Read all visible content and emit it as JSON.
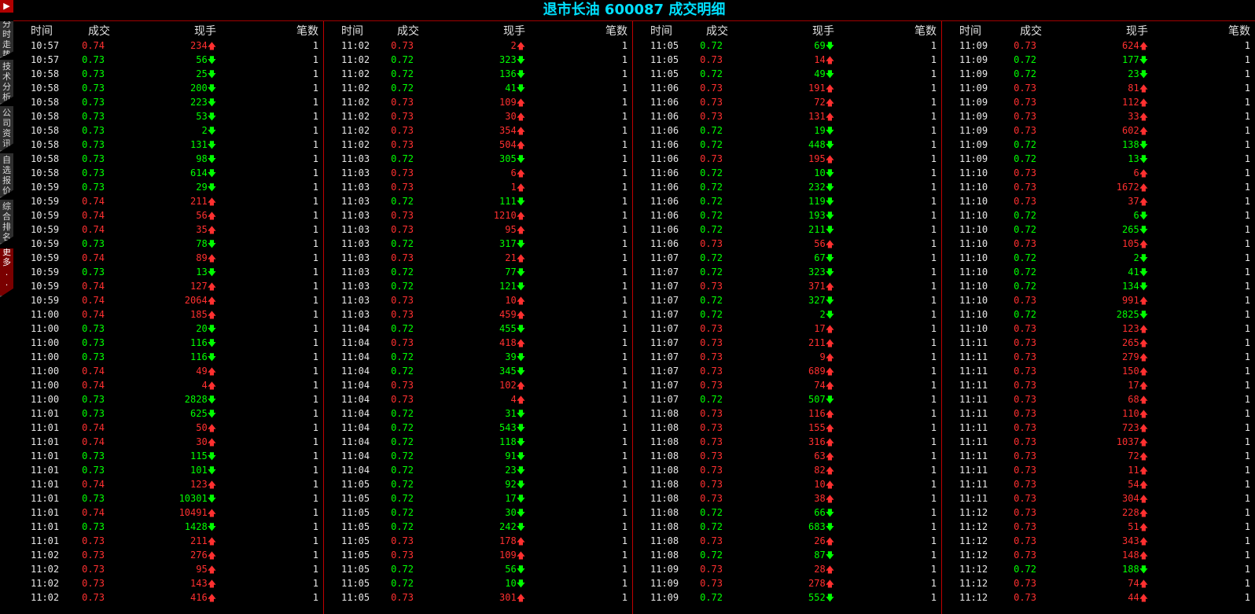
{
  "title": "退市长油 600087 成交明细",
  "sidebar": {
    "top_label": "▶",
    "tabs": [
      "分时走势",
      "技术分析",
      "公司资讯",
      "自选报价",
      "综合排名",
      "更多..."
    ]
  },
  "headers": {
    "time": "时间",
    "price": "成交",
    "volume": "现手",
    "count": "笔数"
  },
  "columns": [
    [
      [
        "10:57",
        "0.74",
        "234",
        "u"
      ],
      [
        "10:57",
        "0.73",
        "56",
        "d"
      ],
      [
        "10:58",
        "0.73",
        "25",
        "d"
      ],
      [
        "10:58",
        "0.73",
        "200",
        "d"
      ],
      [
        "10:58",
        "0.73",
        "223",
        "d"
      ],
      [
        "10:58",
        "0.73",
        "53",
        "d"
      ],
      [
        "10:58",
        "0.73",
        "2",
        "d"
      ],
      [
        "10:58",
        "0.73",
        "131",
        "d"
      ],
      [
        "10:58",
        "0.73",
        "98",
        "d"
      ],
      [
        "10:58",
        "0.73",
        "614",
        "d"
      ],
      [
        "10:59",
        "0.73",
        "29",
        "d"
      ],
      [
        "10:59",
        "0.74",
        "211",
        "u"
      ],
      [
        "10:59",
        "0.74",
        "56",
        "u"
      ],
      [
        "10:59",
        "0.74",
        "35",
        "u"
      ],
      [
        "10:59",
        "0.73",
        "78",
        "d"
      ],
      [
        "10:59",
        "0.74",
        "89",
        "u"
      ],
      [
        "10:59",
        "0.73",
        "13",
        "d"
      ],
      [
        "10:59",
        "0.74",
        "127",
        "u"
      ],
      [
        "10:59",
        "0.74",
        "2064",
        "u"
      ],
      [
        "11:00",
        "0.74",
        "185",
        "u"
      ],
      [
        "11:00",
        "0.73",
        "20",
        "d"
      ],
      [
        "11:00",
        "0.73",
        "116",
        "d"
      ],
      [
        "11:00",
        "0.73",
        "116",
        "d"
      ],
      [
        "11:00",
        "0.74",
        "49",
        "u"
      ],
      [
        "11:00",
        "0.74",
        "4",
        "u"
      ],
      [
        "11:00",
        "0.73",
        "2828",
        "d"
      ],
      [
        "11:01",
        "0.73",
        "625",
        "d"
      ],
      [
        "11:01",
        "0.74",
        "50",
        "u"
      ],
      [
        "11:01",
        "0.74",
        "30",
        "u"
      ],
      [
        "11:01",
        "0.73",
        "115",
        "d"
      ],
      [
        "11:01",
        "0.73",
        "101",
        "d"
      ],
      [
        "11:01",
        "0.74",
        "123",
        "u"
      ],
      [
        "11:01",
        "0.73",
        "10301",
        "d"
      ],
      [
        "11:01",
        "0.74",
        "10491",
        "u"
      ],
      [
        "11:01",
        "0.73",
        "1428",
        "d"
      ],
      [
        "11:01",
        "0.73",
        "211",
        "u"
      ],
      [
        "11:02",
        "0.73",
        "276",
        "u"
      ],
      [
        "11:02",
        "0.73",
        "95",
        "u"
      ],
      [
        "11:02",
        "0.73",
        "143",
        "u"
      ],
      [
        "11:02",
        "0.73",
        "416",
        "u"
      ]
    ],
    [
      [
        "11:02",
        "0.73",
        "2",
        "u"
      ],
      [
        "11:02",
        "0.72",
        "323",
        "d"
      ],
      [
        "11:02",
        "0.72",
        "136",
        "d"
      ],
      [
        "11:02",
        "0.72",
        "41",
        "d"
      ],
      [
        "11:02",
        "0.73",
        "109",
        "u"
      ],
      [
        "11:02",
        "0.73",
        "30",
        "u"
      ],
      [
        "11:02",
        "0.73",
        "354",
        "u"
      ],
      [
        "11:02",
        "0.73",
        "504",
        "u"
      ],
      [
        "11:03",
        "0.72",
        "305",
        "d"
      ],
      [
        "11:03",
        "0.73",
        "6",
        "u"
      ],
      [
        "11:03",
        "0.73",
        "1",
        "u"
      ],
      [
        "11:03",
        "0.72",
        "111",
        "d"
      ],
      [
        "11:03",
        "0.73",
        "1210",
        "u"
      ],
      [
        "11:03",
        "0.73",
        "95",
        "u"
      ],
      [
        "11:03",
        "0.72",
        "317",
        "d"
      ],
      [
        "11:03",
        "0.73",
        "21",
        "u"
      ],
      [
        "11:03",
        "0.72",
        "77",
        "d"
      ],
      [
        "11:03",
        "0.72",
        "121",
        "d"
      ],
      [
        "11:03",
        "0.73",
        "10",
        "u"
      ],
      [
        "11:03",
        "0.73",
        "459",
        "u"
      ],
      [
        "11:04",
        "0.72",
        "455",
        "d"
      ],
      [
        "11:04",
        "0.73",
        "418",
        "u"
      ],
      [
        "11:04",
        "0.72",
        "39",
        "d"
      ],
      [
        "11:04",
        "0.72",
        "345",
        "d"
      ],
      [
        "11:04",
        "0.73",
        "102",
        "u"
      ],
      [
        "11:04",
        "0.73",
        "4",
        "u"
      ],
      [
        "11:04",
        "0.72",
        "31",
        "d"
      ],
      [
        "11:04",
        "0.72",
        "543",
        "d"
      ],
      [
        "11:04",
        "0.72",
        "118",
        "d"
      ],
      [
        "11:04",
        "0.72",
        "91",
        "d"
      ],
      [
        "11:04",
        "0.72",
        "23",
        "d"
      ],
      [
        "11:05",
        "0.72",
        "92",
        "d"
      ],
      [
        "11:05",
        "0.72",
        "17",
        "d"
      ],
      [
        "11:05",
        "0.72",
        "30",
        "d"
      ],
      [
        "11:05",
        "0.72",
        "242",
        "d"
      ],
      [
        "11:05",
        "0.73",
        "178",
        "u"
      ],
      [
        "11:05",
        "0.73",
        "109",
        "u"
      ],
      [
        "11:05",
        "0.72",
        "56",
        "d"
      ],
      [
        "11:05",
        "0.72",
        "10",
        "d"
      ],
      [
        "11:05",
        "0.73",
        "301",
        "u"
      ]
    ],
    [
      [
        "11:05",
        "0.72",
        "69",
        "d"
      ],
      [
        "11:05",
        "0.73",
        "14",
        "u"
      ],
      [
        "11:05",
        "0.72",
        "49",
        "d"
      ],
      [
        "11:06",
        "0.73",
        "191",
        "u"
      ],
      [
        "11:06",
        "0.73",
        "72",
        "u"
      ],
      [
        "11:06",
        "0.73",
        "131",
        "u"
      ],
      [
        "11:06",
        "0.72",
        "19",
        "d"
      ],
      [
        "11:06",
        "0.72",
        "448",
        "d"
      ],
      [
        "11:06",
        "0.73",
        "195",
        "u"
      ],
      [
        "11:06",
        "0.72",
        "10",
        "d"
      ],
      [
        "11:06",
        "0.72",
        "232",
        "d"
      ],
      [
        "11:06",
        "0.72",
        "119",
        "d"
      ],
      [
        "11:06",
        "0.72",
        "193",
        "d"
      ],
      [
        "11:06",
        "0.72",
        "211",
        "d"
      ],
      [
        "11:06",
        "0.73",
        "56",
        "u"
      ],
      [
        "11:07",
        "0.72",
        "67",
        "d"
      ],
      [
        "11:07",
        "0.72",
        "323",
        "d"
      ],
      [
        "11:07",
        "0.73",
        "371",
        "u"
      ],
      [
        "11:07",
        "0.72",
        "327",
        "d"
      ],
      [
        "11:07",
        "0.72",
        "2",
        "d"
      ],
      [
        "11:07",
        "0.73",
        "17",
        "u"
      ],
      [
        "11:07",
        "0.73",
        "211",
        "u"
      ],
      [
        "11:07",
        "0.73",
        "9",
        "u"
      ],
      [
        "11:07",
        "0.73",
        "689",
        "u"
      ],
      [
        "11:07",
        "0.73",
        "74",
        "u"
      ],
      [
        "11:07",
        "0.72",
        "507",
        "d"
      ],
      [
        "11:08",
        "0.73",
        "116",
        "u"
      ],
      [
        "11:08",
        "0.73",
        "155",
        "u"
      ],
      [
        "11:08",
        "0.73",
        "316",
        "u"
      ],
      [
        "11:08",
        "0.73",
        "63",
        "u"
      ],
      [
        "11:08",
        "0.73",
        "82",
        "u"
      ],
      [
        "11:08",
        "0.73",
        "10",
        "u"
      ],
      [
        "11:08",
        "0.73",
        "38",
        "u"
      ],
      [
        "11:08",
        "0.72",
        "66",
        "d"
      ],
      [
        "11:08",
        "0.72",
        "683",
        "d"
      ],
      [
        "11:08",
        "0.73",
        "26",
        "u"
      ],
      [
        "11:08",
        "0.72",
        "87",
        "d"
      ],
      [
        "11:09",
        "0.73",
        "28",
        "u"
      ],
      [
        "11:09",
        "0.73",
        "278",
        "u"
      ],
      [
        "11:09",
        "0.72",
        "552",
        "d"
      ]
    ],
    [
      [
        "11:09",
        "0.73",
        "624",
        "u"
      ],
      [
        "11:09",
        "0.72",
        "177",
        "d"
      ],
      [
        "11:09",
        "0.72",
        "23",
        "d"
      ],
      [
        "11:09",
        "0.73",
        "81",
        "u"
      ],
      [
        "11:09",
        "0.73",
        "112",
        "u"
      ],
      [
        "11:09",
        "0.73",
        "33",
        "u"
      ],
      [
        "11:09",
        "0.73",
        "602",
        "u"
      ],
      [
        "11:09",
        "0.72",
        "138",
        "d"
      ],
      [
        "11:09",
        "0.72",
        "13",
        "d"
      ],
      [
        "11:10",
        "0.73",
        "6",
        "u"
      ],
      [
        "11:10",
        "0.73",
        "1672",
        "u"
      ],
      [
        "11:10",
        "0.73",
        "37",
        "u"
      ],
      [
        "11:10",
        "0.72",
        "6",
        "d"
      ],
      [
        "11:10",
        "0.72",
        "265",
        "d"
      ],
      [
        "11:10",
        "0.73",
        "105",
        "u"
      ],
      [
        "11:10",
        "0.72",
        "2",
        "d"
      ],
      [
        "11:10",
        "0.72",
        "41",
        "d"
      ],
      [
        "11:10",
        "0.72",
        "134",
        "d"
      ],
      [
        "11:10",
        "0.73",
        "991",
        "u"
      ],
      [
        "11:10",
        "0.72",
        "2825",
        "d"
      ],
      [
        "11:10",
        "0.73",
        "123",
        "u"
      ],
      [
        "11:11",
        "0.73",
        "265",
        "u"
      ],
      [
        "11:11",
        "0.73",
        "279",
        "u"
      ],
      [
        "11:11",
        "0.73",
        "150",
        "u"
      ],
      [
        "11:11",
        "0.73",
        "17",
        "u"
      ],
      [
        "11:11",
        "0.73",
        "68",
        "u"
      ],
      [
        "11:11",
        "0.73",
        "110",
        "u"
      ],
      [
        "11:11",
        "0.73",
        "723",
        "u"
      ],
      [
        "11:11",
        "0.73",
        "1037",
        "u"
      ],
      [
        "11:11",
        "0.73",
        "72",
        "u"
      ],
      [
        "11:11",
        "0.73",
        "11",
        "u"
      ],
      [
        "11:11",
        "0.73",
        "54",
        "u"
      ],
      [
        "11:11",
        "0.73",
        "304",
        "u"
      ],
      [
        "11:12",
        "0.73",
        "228",
        "u"
      ],
      [
        "11:12",
        "0.73",
        "51",
        "u"
      ],
      [
        "11:12",
        "0.73",
        "343",
        "u"
      ],
      [
        "11:12",
        "0.73",
        "148",
        "u"
      ],
      [
        "11:12",
        "0.72",
        "188",
        "d"
      ],
      [
        "11:12",
        "0.73",
        "74",
        "u"
      ],
      [
        "11:12",
        "0.73",
        "44",
        "u"
      ]
    ]
  ],
  "count_value": "1",
  "arrows": {
    "up": "🡅",
    "down": "🡇"
  },
  "colors": {
    "up": "#ff3030",
    "down": "#00ff00",
    "title": "#00e0ff",
    "divider": "#c00000"
  }
}
